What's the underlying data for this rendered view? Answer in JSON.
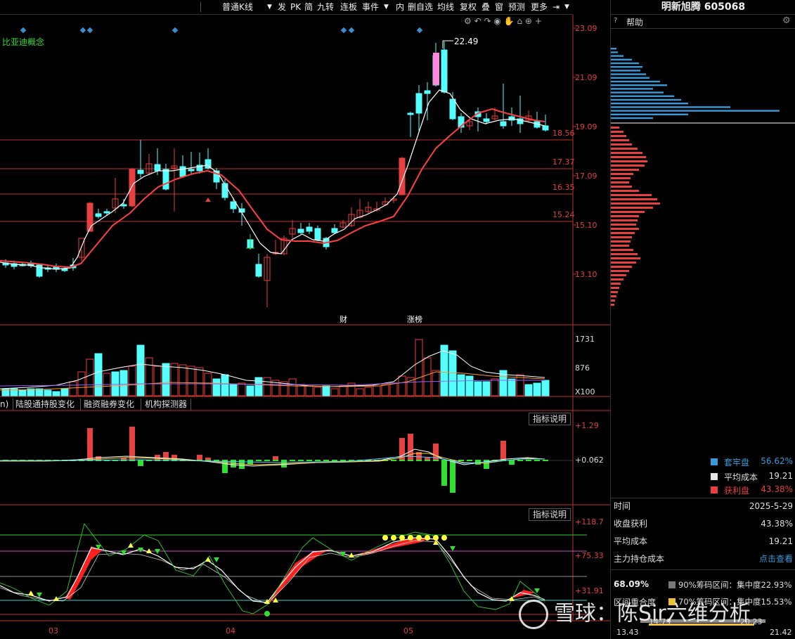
{
  "toolbar": {
    "kline_type": "普通K线",
    "buttons": [
      "发",
      "PK",
      "简",
      "九转",
      "连板",
      "事件",
      "内",
      "删自选",
      "均线",
      "复权",
      "叠",
      "窗",
      "预测",
      "更多"
    ]
  },
  "stock": {
    "name": "明新旭腾",
    "code": "605068"
  },
  "concept_label": "比亚迪概念",
  "price_axis": {
    "ticks": [
      "23.09",
      "21.09",
      "19.09",
      "17.09",
      "15.10",
      "13.10"
    ]
  },
  "level_labels": [
    "18.56",
    "17.37",
    "16.35",
    "15.24"
  ],
  "peak_label": "22.49",
  "event_markers": {
    "finance": "财",
    "limit_up": "涨榜"
  },
  "volume_axis": {
    "ticks": [
      "1731",
      "876"
    ],
    "unit": "X100"
  },
  "tabs": [
    "陆股通持股变化",
    "融资融券变化",
    "机构探测器"
  ],
  "tab_partial": "n)",
  "macd_panel": {
    "help": "指标说明",
    "ticks": [
      "+1.29",
      "+0.062"
    ]
  },
  "kdj_panel": {
    "help": "指标说明",
    "ticks": [
      "+118.7",
      "+75.33",
      "+31.91"
    ]
  },
  "x_axis": {
    "months": [
      "03",
      "04",
      "05"
    ]
  },
  "right_panel": {
    "help_label": "帮助",
    "legend": [
      {
        "label": "套牢盘",
        "value": "56.62%",
        "color": "#3a9ad9"
      },
      {
        "label": "平均成本",
        "value": "19.21",
        "color": "#e6e6e6"
      },
      {
        "label": "获利盘",
        "value": "43.38%",
        "color": "#e84040"
      }
    ],
    "rows": [
      {
        "label": "时间",
        "value": "2025-5-29"
      },
      {
        "label": "收盘获利",
        "value": "43.38%"
      },
      {
        "label": "平均成本",
        "value": "19.21"
      },
      {
        "label": "主力持仓成本",
        "value": "点击查看"
      }
    ],
    "concentration": {
      "pct": "68.09%",
      "line90": "90%筹码区间：集中度22.93%",
      "overlap_label": "区间重合度",
      "line70": "70%筹码区间：集中度15.53%",
      "range_low": "14.79",
      "range_high": "20.23",
      "min": "13.43",
      "max": "21.42"
    }
  },
  "watermark": "雪球：陈Sir六维分析",
  "colors": {
    "up": "#e84040",
    "down": "#54ffff",
    "ma_fast": "#ffffff",
    "ma_slow": "#ff4040",
    "grid": "#c03030"
  }
}
